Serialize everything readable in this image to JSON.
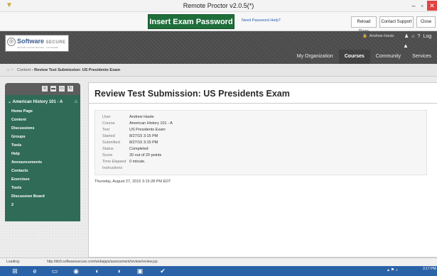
{
  "window": {
    "title": "Remote Proctor v2.0.5(*)",
    "app_icon": "shield-icon",
    "min": "–",
    "max": "▫",
    "close": "✕"
  },
  "toolbar": {
    "insert_button": "Insert Exam Password",
    "help_link": "Need Password Help?",
    "reload": "Reload Page",
    "contact": "Contact Support",
    "close": "Close"
  },
  "header": {
    "logo_main": "Software",
    "logo_secure": "SECURE",
    "logo_tag": "SECURE ONLINE TESTING · ANYWHERE",
    "user_name": "Andrew Haste",
    "logout": "Log",
    "nav": [
      "My Organization",
      "Courses",
      "Community",
      "Services"
    ],
    "active_nav": "Courses"
  },
  "breadcrumb": {
    "content": "Content",
    "separator": "›",
    "current": "Review Test Submission: US Presidents Exam"
  },
  "course_menu": {
    "title": "American History 101 - A",
    "items": [
      "Home Page",
      "Content",
      "Discussions",
      "Groups",
      "Tools",
      "Help",
      "Announcements",
      "Contacts",
      "Exercises",
      "Tools",
      "Discussion Board",
      "2"
    ]
  },
  "page": {
    "title": "Review Test Submission: US Presidents Exam",
    "details": [
      {
        "key": "User",
        "value": "Andrew Haste"
      },
      {
        "key": "Course",
        "value": "American History 101 - A"
      },
      {
        "key": "Test",
        "value": "US Presidents Exam"
      },
      {
        "key": "Started",
        "value": "8/27/15 3:15 PM"
      },
      {
        "key": "Submitted",
        "value": "8/27/15 3:15 PM"
      },
      {
        "key": "Status",
        "value": "Completed"
      },
      {
        "key": "Score",
        "value": "20 out of 20 points"
      },
      {
        "key": "Time Elapsed",
        "value": "0 minute."
      },
      {
        "key": "Instructions",
        "value": ""
      }
    ],
    "date_line": "Thursday, August 27, 2015 3:15:28 PM EDT"
  },
  "status": {
    "loading": "Loading:",
    "url": "http://bb9.softwaresecure.com/webapps/assessment/review/review.jsp"
  },
  "taskbar": {
    "time": "3:17 PM"
  },
  "colors": {
    "insert_button": "#1f6e3a",
    "course_menu": "#2f6b56",
    "header": "#4d4d4d",
    "taskbar": "#2a62a8"
  }
}
